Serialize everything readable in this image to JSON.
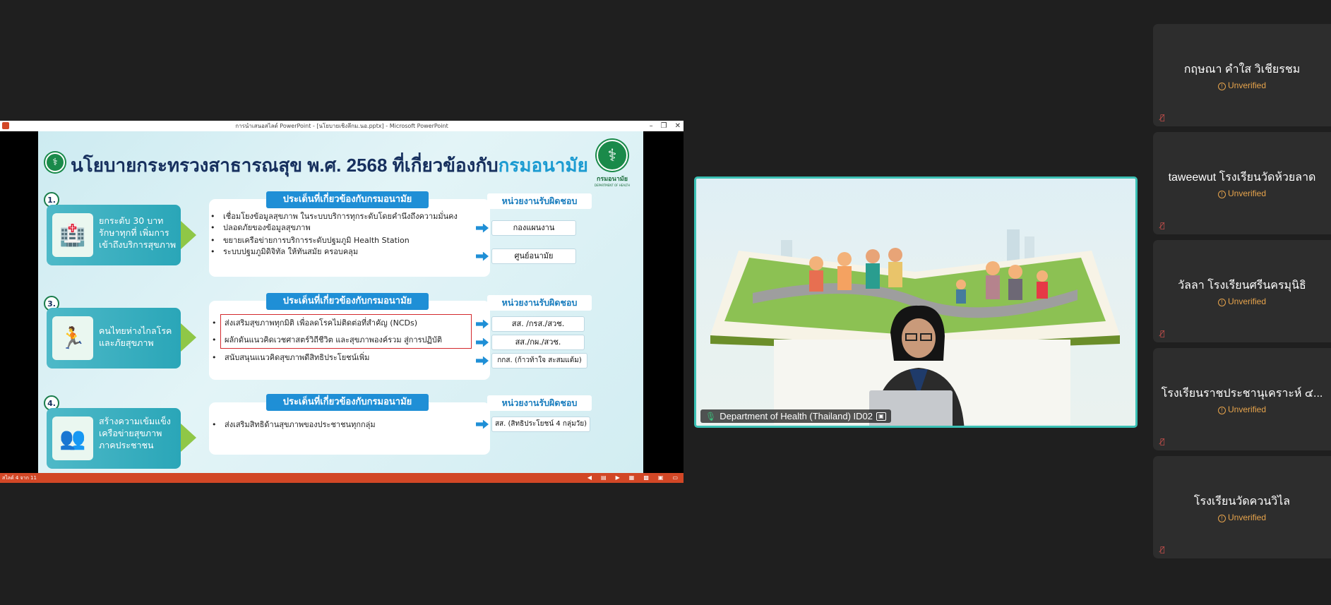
{
  "powerpoint": {
    "title": "การนำเสนอสไลด์ PowerPoint - [นโยบายเชิงลึกม.นอ.pptx] - Microsoft PowerPoint",
    "status_left": "สไลด์ 4 จาก 11"
  },
  "slide": {
    "title_main": "นโยบายกระทรวงสาธารณสุข พ.ศ. 2568",
    "title_highlight_1": "ที่เกี่ยวข้องกับ",
    "title_highlight_2": "กรมอนามัย",
    "logo_name": "กรมอนามัย",
    "logo_sub": "DEPARTMENT OF HEALTH",
    "sections": [
      {
        "number": "1.",
        "left_text": "ยกระดับ 30 บาท รักษาทุกที่ เพิ่มการเข้าถึงบริการสุขภาพ",
        "header": "ประเด็นที่เกี่ยวข้องกับกรมอนามัย",
        "unit_header": "หน่วยงานรับผิดชอบ",
        "bullets": [
          "เชื่อมโยงข้อมูลสุขภาพ ในระบบบริการทุกระดับโดยคำนึงถึงความมั่นคง",
          "ปลอดภัยของข้อมูลสุขภาพ",
          "ขยายเครือข่ายการบริการระดับปฐมภูมิ Health Station",
          "ระบบปฐมภูมิดิจิทัล ให้ทันสมัย ครอบคลุม"
        ],
        "units": [
          "กองแผนงาน",
          "ศูนย์อนามัย"
        ]
      },
      {
        "number": "3.",
        "left_text": "คนไทยห่างไกลโรค และภัยสุขภาพ",
        "header": "ประเด็นที่เกี่ยวข้องกับกรมอนามัย",
        "unit_header": "หน่วยงานรับผิดชอบ",
        "bullets": [
          "ส่งเสริมสุขภาพทุกมิติ เพื่อลดโรคไม่ติดต่อที่สำคัญ (NCDs)",
          "ผลักดันแนวคิดเวชศาสตร์วิถีชีวิต และสุขภาพองค์รวม สู่การปฏิบัติ",
          "สนับสนุนแนวคิดสุขภาพดีสิทธิประโยชน์เพิ่ม"
        ],
        "units": [
          "สส. /กรส./สวช.",
          "สส./กผ./สวช.",
          "กกส. (ก้าวท้าใจ สะสมแต้ม)"
        ]
      },
      {
        "number": "4.",
        "left_text": "สร้างความเข้มแข็ง เครือข่ายสุขภาพ ภาคประชาชน",
        "header": "ประเด็นที่เกี่ยวข้องกับกรมอนามัย",
        "unit_header": "หน่วยงานรับผิดชอบ",
        "bullets": [
          "ส่งเสริมสิทธิด้านสุขภาพของประชาชนทุกกลุ่ม"
        ],
        "units": [
          "สส. (สิทธิประโยชน์ 4 กลุ่มวัย)"
        ]
      }
    ]
  },
  "presenter": {
    "name": "Department of Health (Thailand) ID02"
  },
  "participants": [
    {
      "name": "กฤษณา คำใส วิเชียรชม",
      "status": "Unverified"
    },
    {
      "name": "taweewut โรงเรียนวัดห้วยลาด",
      "status": "Unverified"
    },
    {
      "name": "วัลลา  โรงเรียนศรีนครมุนิธิ",
      "status": "Unverified"
    },
    {
      "name": "โรงเรียนราชประชานุเคราะห์ ๔...",
      "status": "Unverified"
    },
    {
      "name": "โรงเรียนวัดควนวิไล",
      "status": "Unverified"
    }
  ],
  "icons": {
    "mic_muted": "mic-muted-icon",
    "warning": "warning-circle-icon",
    "mic": "mic-icon"
  },
  "colors": {
    "background": "#1f1f1f",
    "active_speaker_border": "#3ac0b4",
    "unverified": "#e7a44c",
    "ppt_accent": "#d24726"
  }
}
